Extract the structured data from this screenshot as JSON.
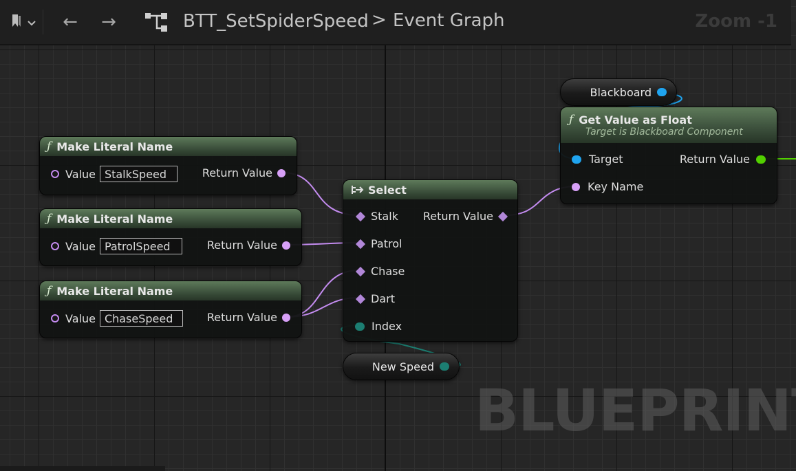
{
  "toolbar": {
    "back_glyph": "←",
    "forward_glyph": "→",
    "breadcrumb": {
      "asset": "BTT_SetSpiderSpeed",
      "separator": ">",
      "graph": "Event Graph"
    },
    "zoom": "Zoom -1"
  },
  "icons": [
    "bookmark-icon",
    "chevron-down-icon",
    "back-arrow-icon",
    "forward-arrow-icon",
    "graph-icon",
    "function-icon",
    "select-icon"
  ],
  "colors": {
    "name_pin": "#d7a0f7",
    "wildcard_pin": "#b187d8",
    "object_pin": "#1fa4ef",
    "float_pin": "#52d000",
    "int_pin": "#1c7e72",
    "function_header": "#3b4f3b"
  },
  "nodes": {
    "literal_1": {
      "function_glyph": "ƒ",
      "title": "Make Literal Name",
      "input_label": "Value",
      "input_value": "StalkSpeed",
      "output_label": "Return Value"
    },
    "literal_2": {
      "function_glyph": "ƒ",
      "title": "Make Literal Name",
      "input_label": "Value",
      "input_value": "PatrolSpeed",
      "output_label": "Return Value"
    },
    "literal_3": {
      "function_glyph": "ƒ",
      "title": "Make Literal Name",
      "input_label": "Value",
      "input_value": "ChaseSpeed",
      "output_label": "Return Value"
    },
    "select": {
      "title": "Select",
      "options": [
        "Stalk",
        "Patrol",
        "Chase",
        "Dart"
      ],
      "index_label": "Index",
      "output_label": "Return Value"
    },
    "blackboard_var": {
      "label": "Blackboard"
    },
    "get_value": {
      "function_glyph": "ƒ",
      "title": "Get Value as Float",
      "subtitle": "Target is Blackboard Component",
      "target_label": "Target",
      "key_label": "Key Name",
      "output_label": "Return Value"
    },
    "new_speed_var": {
      "label": "New Speed"
    }
  },
  "watermark": "BLUEPRINT"
}
